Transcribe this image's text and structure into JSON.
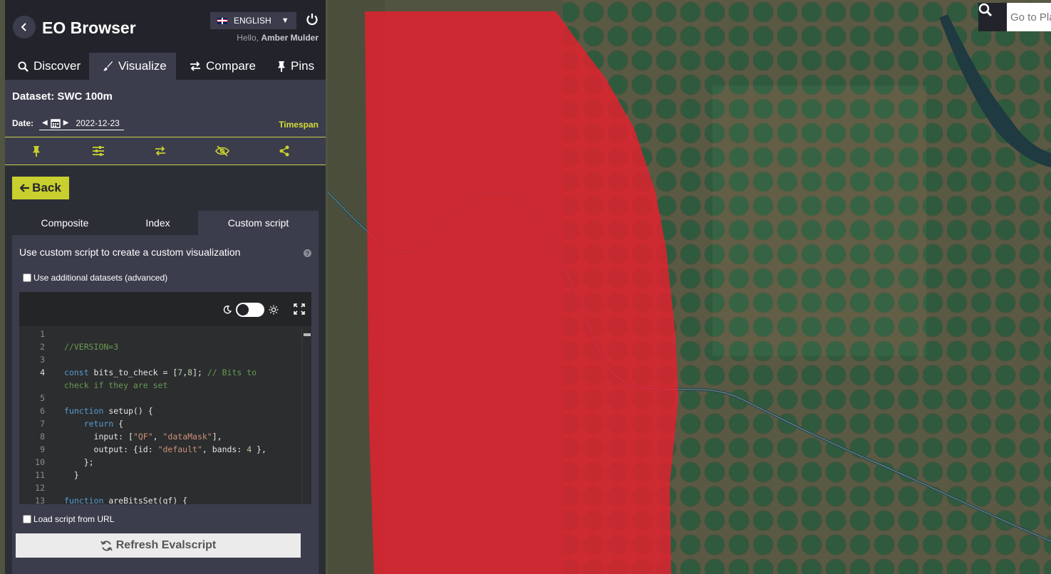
{
  "app": {
    "title": "EO Browser"
  },
  "header": {
    "language": "ENGLISH",
    "greeting": "Hello,",
    "user": "Amber Mulder"
  },
  "tabs": [
    {
      "label": "Discover",
      "icon": "search-icon"
    },
    {
      "label": "Visualize",
      "icon": "paintbrush-icon",
      "active": true
    },
    {
      "label": "Compare",
      "icon": "compare-arrows-icon"
    },
    {
      "label": "Pins",
      "icon": "pin-icon"
    }
  ],
  "dataset": {
    "label": "Dataset: SWC 100m"
  },
  "date": {
    "label": "Date:",
    "value": "2022-12-23",
    "timespan": "Timespan"
  },
  "toolbar": [
    "pin-icon",
    "sliders-icon",
    "compare-arrows-icon",
    "eye-slash-icon",
    "share-icon"
  ],
  "back_button": "Back",
  "vis_tabs": [
    {
      "label": "Composite"
    },
    {
      "label": "Index"
    },
    {
      "label": "Custom script",
      "active": true
    }
  ],
  "custom_script": {
    "description": "Use custom script to create a custom visualization",
    "help": "?",
    "additional_datasets": "Use additional datasets (advanced)",
    "load_from_url": "Load script from URL",
    "refresh": "Refresh Evalscript"
  },
  "code_lines": [
    {
      "n": "1",
      "t": ""
    },
    {
      "n": "2",
      "t": "//VERSION=3"
    },
    {
      "n": "3",
      "t": ""
    },
    {
      "n": "4",
      "t": "const bits_to_check = [7,8]; // Bits to"
    },
    {
      "n": "",
      "t": "check if they are set"
    },
    {
      "n": "5",
      "t": ""
    },
    {
      "n": "6",
      "t": "function setup() {"
    },
    {
      "n": "7",
      "t": "    return {"
    },
    {
      "n": "8",
      "t": "      input: [\"QF\", \"dataMask\"],"
    },
    {
      "n": "9",
      "t": "      output: {id: \"default\", bands: 4 },"
    },
    {
      "n": "10",
      "t": "    };"
    },
    {
      "n": "11",
      "t": "  }"
    },
    {
      "n": "12",
      "t": ""
    },
    {
      "n": "13",
      "t": "function areBitsSet(qf) {"
    }
  ],
  "map": {
    "search_placeholder": "Go to Pla",
    "overlay_color": "#e8202e"
  },
  "colors": {
    "accent": "#c8cf2e",
    "panel": "#3b3d4c",
    "header": "#23242b"
  }
}
